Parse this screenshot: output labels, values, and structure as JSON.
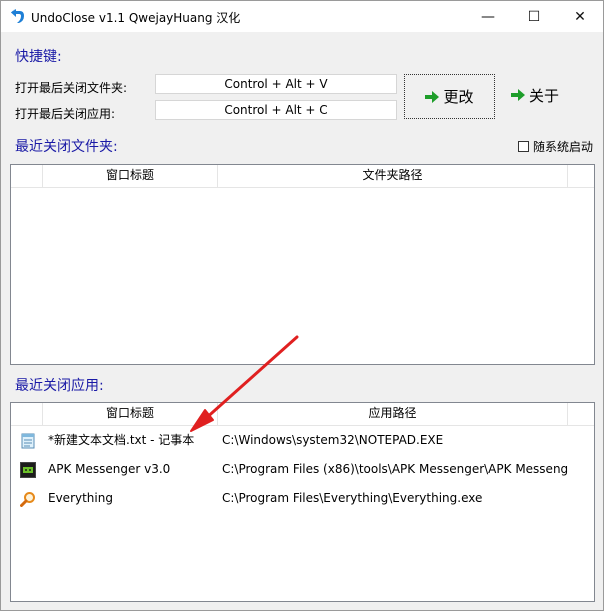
{
  "window": {
    "title": "UndoClose v1.1  QwejayHuang 汉化",
    "minimize_glyph": "—",
    "maximize_glyph": "☐",
    "close_glyph": "✕"
  },
  "hotkeys": {
    "section_title": "快捷键:",
    "folder_label": "打开最后关闭文件夹:",
    "folder_value": "Control + Alt + V",
    "app_label": "打开最后关闭应用:",
    "app_value": "Control + Alt + C",
    "change_label": "更改",
    "about_label": "关于"
  },
  "options": {
    "autostart_label": "随系统启动",
    "autostart_checked": false
  },
  "folders": {
    "section_title": "最近关闭文件夹:",
    "columns": [
      "窗口标题",
      "文件夹路径"
    ],
    "rows": []
  },
  "apps": {
    "section_title": "最近关闭应用:",
    "columns": [
      "窗口标题",
      "应用路径"
    ],
    "rows": [
      {
        "title": "*新建文本文档.txt - 记事本",
        "path": "C:\\Windows\\system32\\NOTEPAD.EXE",
        "icon": "notepad-icon"
      },
      {
        "title": "APK Messenger v3.0",
        "path": "C:\\Program Files (x86)\\tools\\APK Messenger\\APK Messeng",
        "icon": "apk-messenger-icon"
      },
      {
        "title": "Everything",
        "path": "C:\\Program Files\\Everything\\Everything.exe",
        "icon": "everything-icon"
      }
    ]
  },
  "colors": {
    "section_title": "#1a1aa6",
    "arrow_green": "#1e9e2a",
    "annotation_red": "#e02020"
  }
}
